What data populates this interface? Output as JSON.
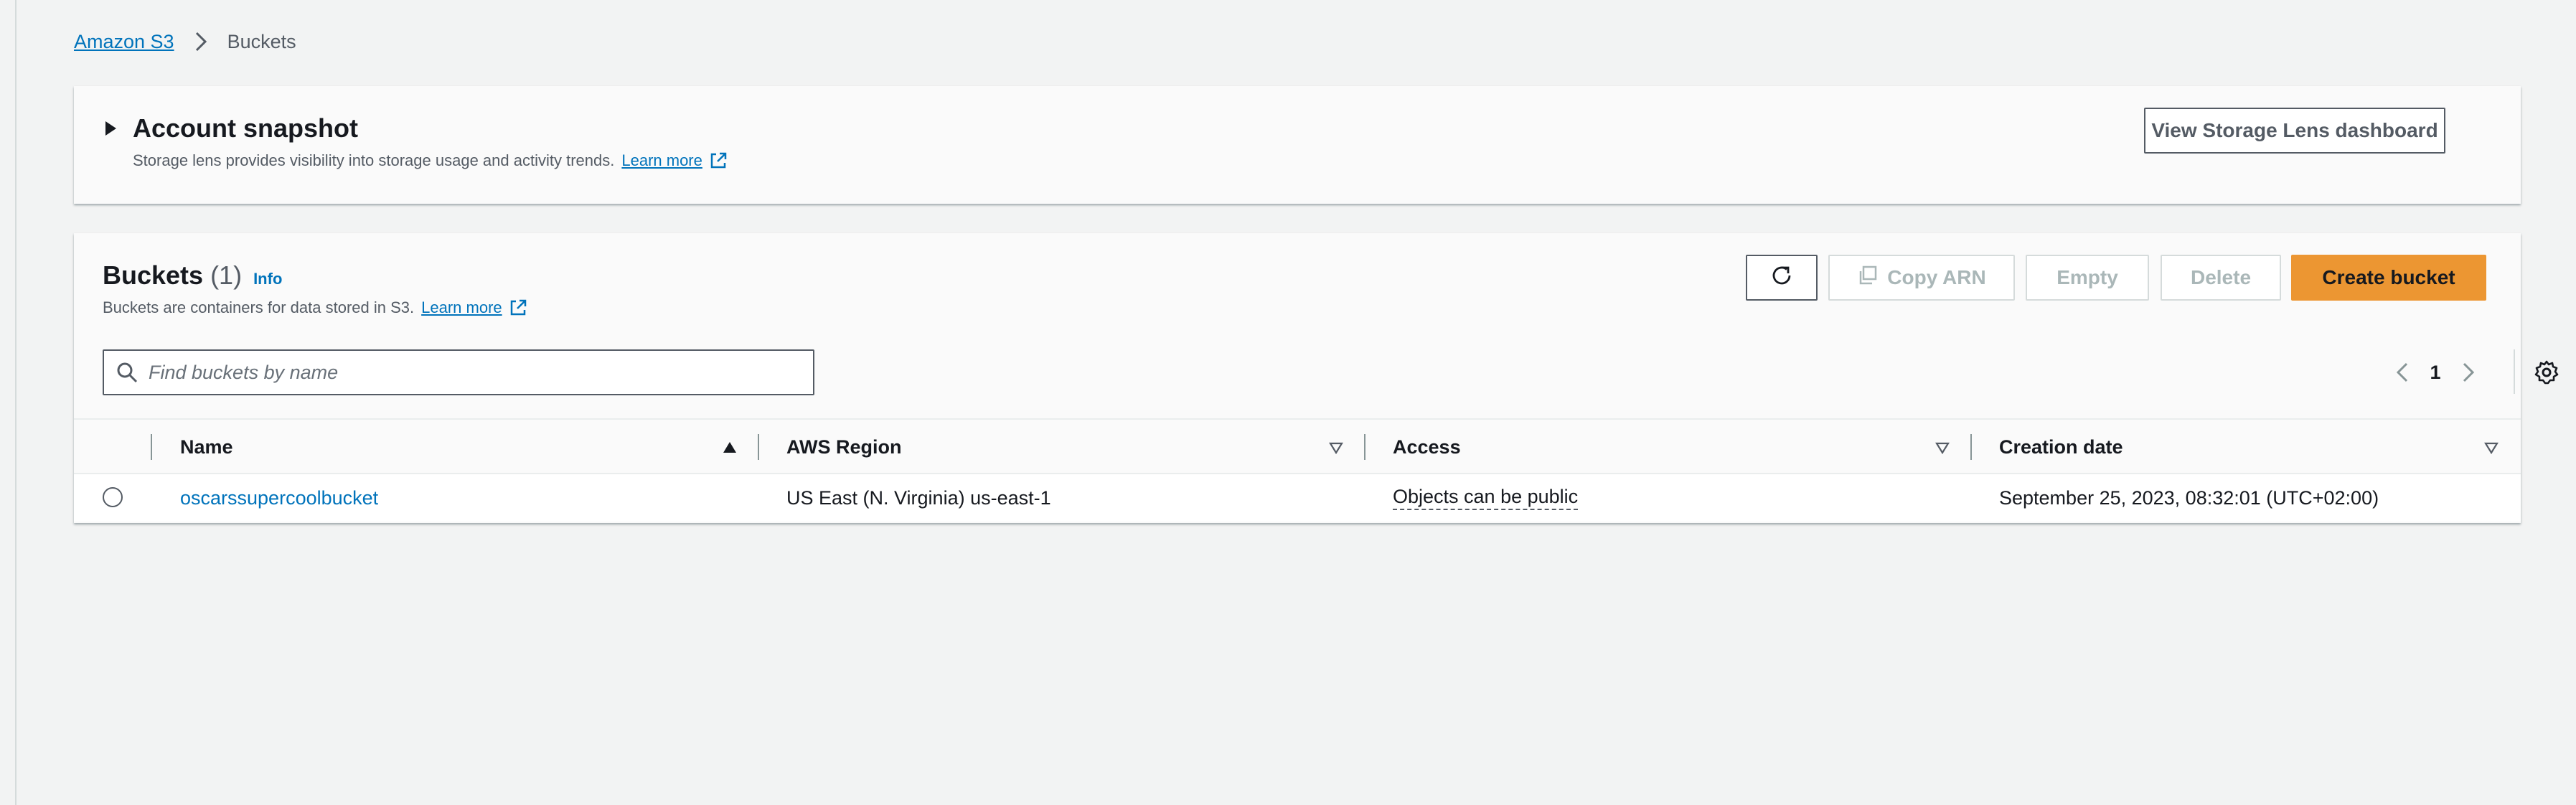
{
  "breadcrumb": {
    "root": "Amazon S3",
    "current": "Buckets"
  },
  "snapshot": {
    "title": "Account snapshot",
    "description": "Storage lens provides visibility into storage usage and activity trends.",
    "learn_more": "Learn more",
    "view_button": "View Storage Lens dashboard"
  },
  "buckets": {
    "title": "Buckets",
    "count": "(1)",
    "info": "Info",
    "description": "Buckets are containers for data stored in S3.",
    "learn_more": "Learn more",
    "actions": {
      "copy_arn": "Copy ARN",
      "empty": "Empty",
      "delete": "Delete",
      "create": "Create bucket"
    },
    "search_placeholder": "Find buckets by name",
    "page": "1",
    "columns": {
      "name": "Name",
      "region": "AWS Region",
      "access": "Access",
      "created": "Creation date"
    },
    "rows": [
      {
        "name": "oscarssupercoolbucket",
        "region": "US East (N. Virginia) us-east-1",
        "access": "Objects can be public",
        "created": "September 25, 2023, 08:32:01 (UTC+02:00)"
      }
    ]
  },
  "colors": {
    "link": "#0073bb",
    "primary": "#ec9632",
    "background": "#f2f3f3"
  }
}
